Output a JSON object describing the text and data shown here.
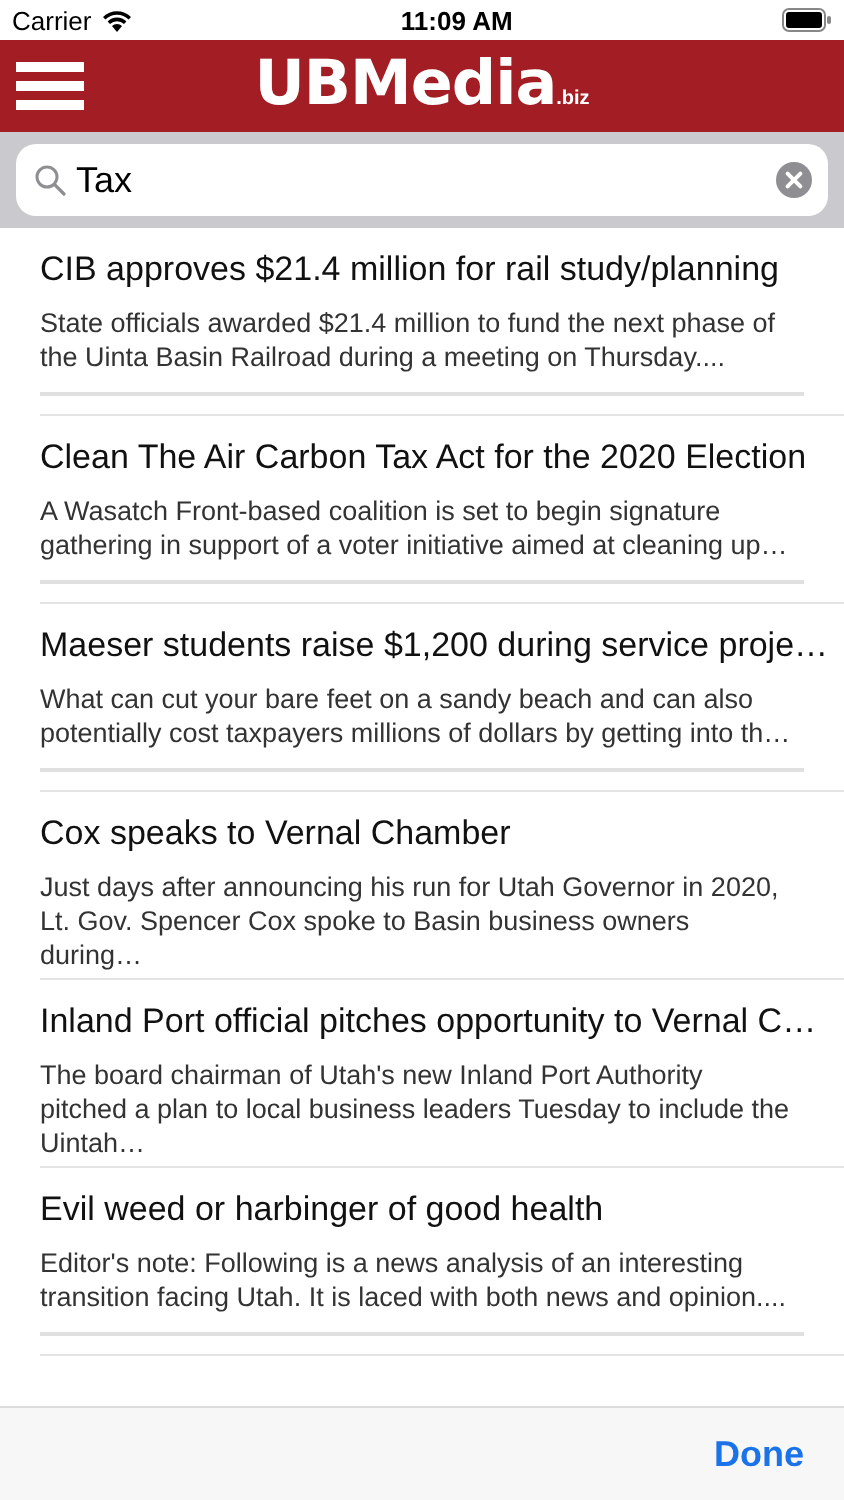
{
  "status_bar": {
    "carrier": "Carrier",
    "time": "11:09 AM"
  },
  "header": {
    "logo_main": "UBMedia",
    "logo_suffix": ".biz"
  },
  "search": {
    "value": "Tax"
  },
  "articles": [
    {
      "title": "CIB approves $21.4 million for rail study/planning",
      "summary": "State officials awarded $21.4 million to fund the next phase of the Uinta Basin Railroad during a meeting on Thursday...."
    },
    {
      "title": "Clean The Air Carbon Tax Act for the 2020 Election",
      "summary": "A Wasatch Front-based coalition is set to begin signature gathering in support of a voter initiative aimed at cleaning up…"
    },
    {
      "title": "Maeser students raise $1,200 during service proje…",
      "summary": "What can cut your bare feet on a sandy beach and can also potentially cost taxpayers millions of dollars by getting into th…"
    },
    {
      "title": "Cox speaks to Vernal Chamber",
      "summary": "Just days after announcing his run for Utah Governor in 2020, Lt. Gov. Spencer Cox spoke to Basin business owners during…"
    },
    {
      "title": "Inland Port official pitches opportunity to Vernal C…",
      "summary": "The board chairman of Utah's new Inland Port Authority pitched a plan to local business leaders Tuesday to include the Uintah…"
    },
    {
      "title": "Evil weed or harbinger of good health",
      "summary": "Editor's note: Following is a news analysis of an interesting transition facing Utah. It is laced with both news and opinion...."
    }
  ],
  "toolbar": {
    "done": "Done"
  }
}
